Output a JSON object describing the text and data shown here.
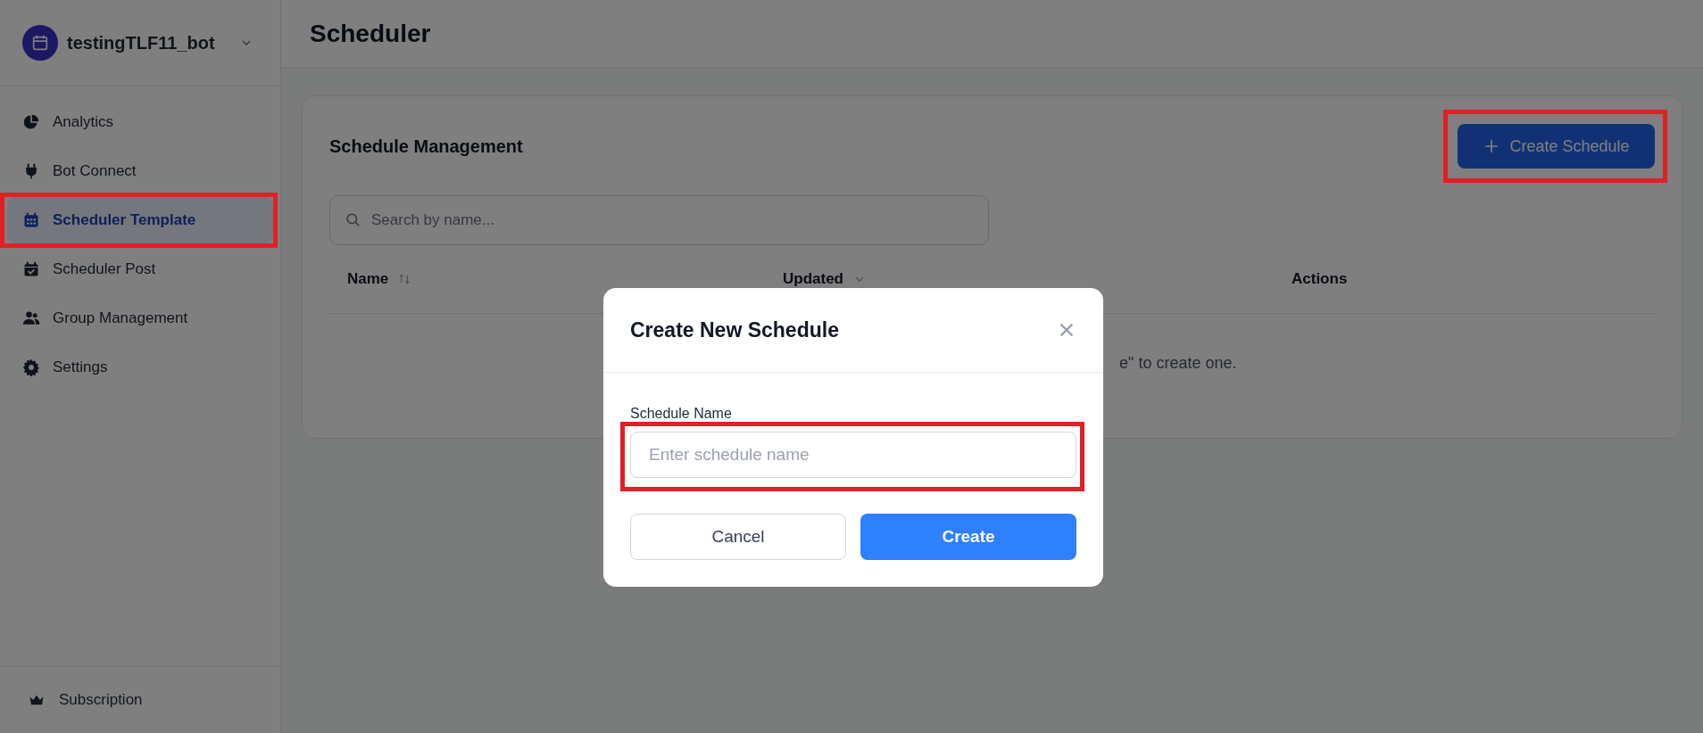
{
  "sidebar": {
    "bot_name": "testingTLF11_bot",
    "items": [
      {
        "label": "Analytics",
        "selected": false,
        "highlighted": false
      },
      {
        "label": "Bot Connect",
        "selected": false,
        "highlighted": false
      },
      {
        "label": "Scheduler Template",
        "selected": true,
        "highlighted": true
      },
      {
        "label": "Scheduler Post",
        "selected": false,
        "highlighted": false
      },
      {
        "label": "Group Management",
        "selected": false,
        "highlighted": false
      },
      {
        "label": "Settings",
        "selected": false,
        "highlighted": false
      }
    ],
    "footer_item": {
      "label": "Subscription"
    }
  },
  "header": {
    "title": "Scheduler"
  },
  "card": {
    "title": "Schedule Management",
    "create_button": {
      "label": "Create Schedule",
      "highlighted": true
    },
    "search": {
      "placeholder": "Search by name..."
    },
    "columns": [
      {
        "label": "Name",
        "sortable": true,
        "sorted": false
      },
      {
        "label": "Updated",
        "sortable": true,
        "sorted": true
      },
      {
        "label": "Actions",
        "sortable": false
      }
    ],
    "empty_text": "e\" to create one."
  },
  "dialog": {
    "title": "Create New Schedule",
    "field": {
      "label": "Schedule Name",
      "placeholder": "Enter schedule name",
      "highlighted": true
    },
    "buttons": [
      {
        "label": "Cancel",
        "kind": "secondary"
      },
      {
        "label": "Create",
        "kind": "primary"
      }
    ]
  }
}
